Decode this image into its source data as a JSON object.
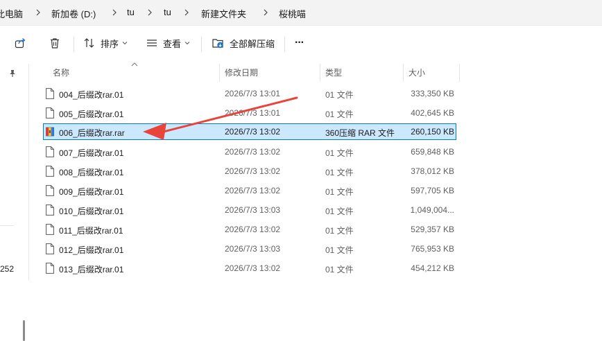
{
  "breadcrumb": [
    "此电脑",
    "新加卷 (D:)",
    "tu",
    "tu",
    "新建文件夹",
    "桜桃喵"
  ],
  "toolbar": {
    "sort_label": "排序",
    "view_label": "查看",
    "extract_label": "全部解压缩",
    "more_label": "···"
  },
  "nav": {
    "partial_text": "252"
  },
  "columns": {
    "name": "名称",
    "modified": "修改日期",
    "type": "类型",
    "size": "大小"
  },
  "files": [
    {
      "name": "004_后缀改rar.01",
      "modified": "2026/7/3 13:01",
      "type": "01 文件",
      "size": "333,350 KB",
      "icon": "file-icon"
    },
    {
      "name": "005_后缀改rar.01",
      "modified": "2026/7/3 13:01",
      "type": "01 文件",
      "size": "402,645 KB",
      "icon": "file-icon"
    },
    {
      "name": "006_后缀改rar.rar",
      "modified": "2026/7/3 13:02",
      "type": "360压缩 RAR 文件",
      "size": "260,150 KB",
      "icon": "rar-archive-icon",
      "selected": true
    },
    {
      "name": "007_后缀改rar.01",
      "modified": "2026/7/3 13:02",
      "type": "01 文件",
      "size": "659,848 KB",
      "icon": "file-icon"
    },
    {
      "name": "008_后缀改rar.01",
      "modified": "2026/7/3 13:02",
      "type": "01 文件",
      "size": "378,012 KB",
      "icon": "file-icon"
    },
    {
      "name": "009_后缀改rar.01",
      "modified": "2026/7/3 13:02",
      "type": "01 文件",
      "size": "597,705 KB",
      "icon": "file-icon"
    },
    {
      "name": "010_后缀改rar.01",
      "modified": "2026/7/3 13:03",
      "type": "01 文件",
      "size": "1,049,004...",
      "icon": "file-icon"
    },
    {
      "name": "011_后缀改rar.01",
      "modified": "2026/7/3 13:02",
      "type": "01 文件",
      "size": "529,357 KB",
      "icon": "file-icon"
    },
    {
      "name": "012_后缀改rar.01",
      "modified": "2026/7/3 13:03",
      "type": "01 文件",
      "size": "765,953 KB",
      "icon": "file-icon"
    },
    {
      "name": "013_后缀改rar.01",
      "modified": "2026/7/3 13:02",
      "type": "01 文件",
      "size": "454,212 KB",
      "icon": "file-icon"
    }
  ],
  "colors": {
    "selection_bg": "#cce8ff",
    "selection_border": "#0078d4",
    "annotation_arrow": "#e8443a"
  }
}
